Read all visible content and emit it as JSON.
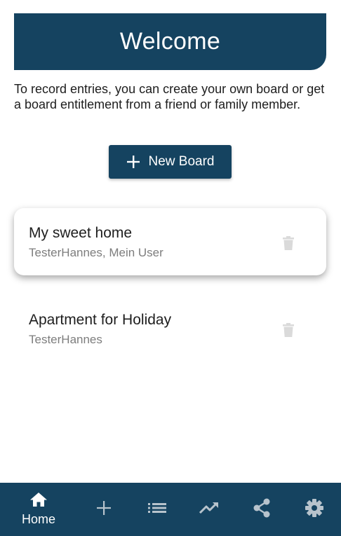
{
  "header": {
    "title": "Welcome"
  },
  "intro": {
    "text": "To record entries, you can create your own board or get a board entitlement from a friend or family member."
  },
  "actions": {
    "new_board_label": "New Board"
  },
  "boards": [
    {
      "name": "My sweet home",
      "members": "TesterHannes, Mein User",
      "selected": true
    },
    {
      "name": "Apartment for Holiday",
      "members": "TesterHannes",
      "selected": false
    }
  ],
  "bottom_nav": {
    "active": "home",
    "items": [
      {
        "id": "home",
        "label": "Home",
        "icon": "home-icon"
      },
      {
        "id": "add",
        "label": "",
        "icon": "plus-icon"
      },
      {
        "id": "list",
        "label": "",
        "icon": "list-icon"
      },
      {
        "id": "stats",
        "label": "",
        "icon": "trending-up-icon"
      },
      {
        "id": "share",
        "label": "",
        "icon": "share-icon"
      },
      {
        "id": "settings",
        "label": "",
        "icon": "gear-icon"
      }
    ]
  },
  "colors": {
    "primary": "#154360",
    "on_primary": "#ffffff",
    "inactive_icon": "#b7c3cc",
    "trash_icon": "#dadada",
    "secondary_text": "#7d7d7d"
  }
}
